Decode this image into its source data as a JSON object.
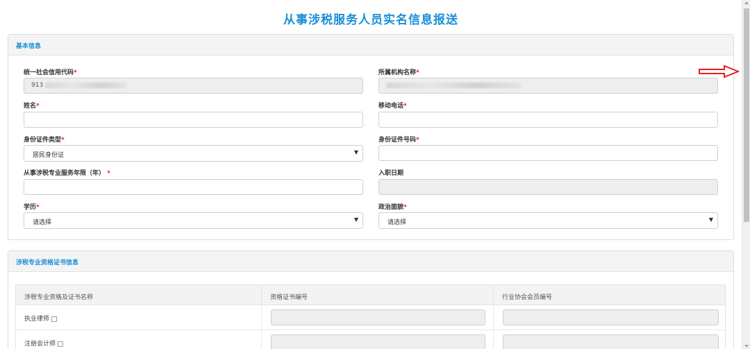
{
  "page_title": "从事涉税服务人员实名信息报送",
  "basic_info": {
    "section_title": "基本信息",
    "credit_code": {
      "label": "统一社会信用代码",
      "value_prefix": "913"
    },
    "org_name": {
      "label": "所属机构名称"
    },
    "name": {
      "label": "姓名",
      "value": ""
    },
    "mobile": {
      "label": "移动电话",
      "value": ""
    },
    "id_type": {
      "label": "身份证件类型",
      "selected": "居民身份证"
    },
    "id_number": {
      "label": "身份证件号码",
      "value": ""
    },
    "service_years": {
      "label": "从事涉税专业服务年限（年）",
      "value": ""
    },
    "hire_date": {
      "label": "入职日期",
      "value": ""
    },
    "education": {
      "label": "学历",
      "selected": "请选择"
    },
    "political_status": {
      "label": "政治面貌",
      "selected": "请选择"
    },
    "required_mark": "*"
  },
  "cert_info": {
    "section_title": "涉税专业资格证书信息",
    "columns": [
      "涉税专业资格及证书名称",
      "资格证书编号",
      "行业协会会员编号"
    ],
    "rows": [
      {
        "name": "执业律师"
      },
      {
        "name": "注册会计师"
      }
    ]
  },
  "colors": {
    "accent": "#1a8fd6",
    "required": "#e02020",
    "arrow": "#e02020"
  },
  "icons": {
    "dropdown": "caret-down-icon",
    "annotation": "red-arrow-icon"
  }
}
